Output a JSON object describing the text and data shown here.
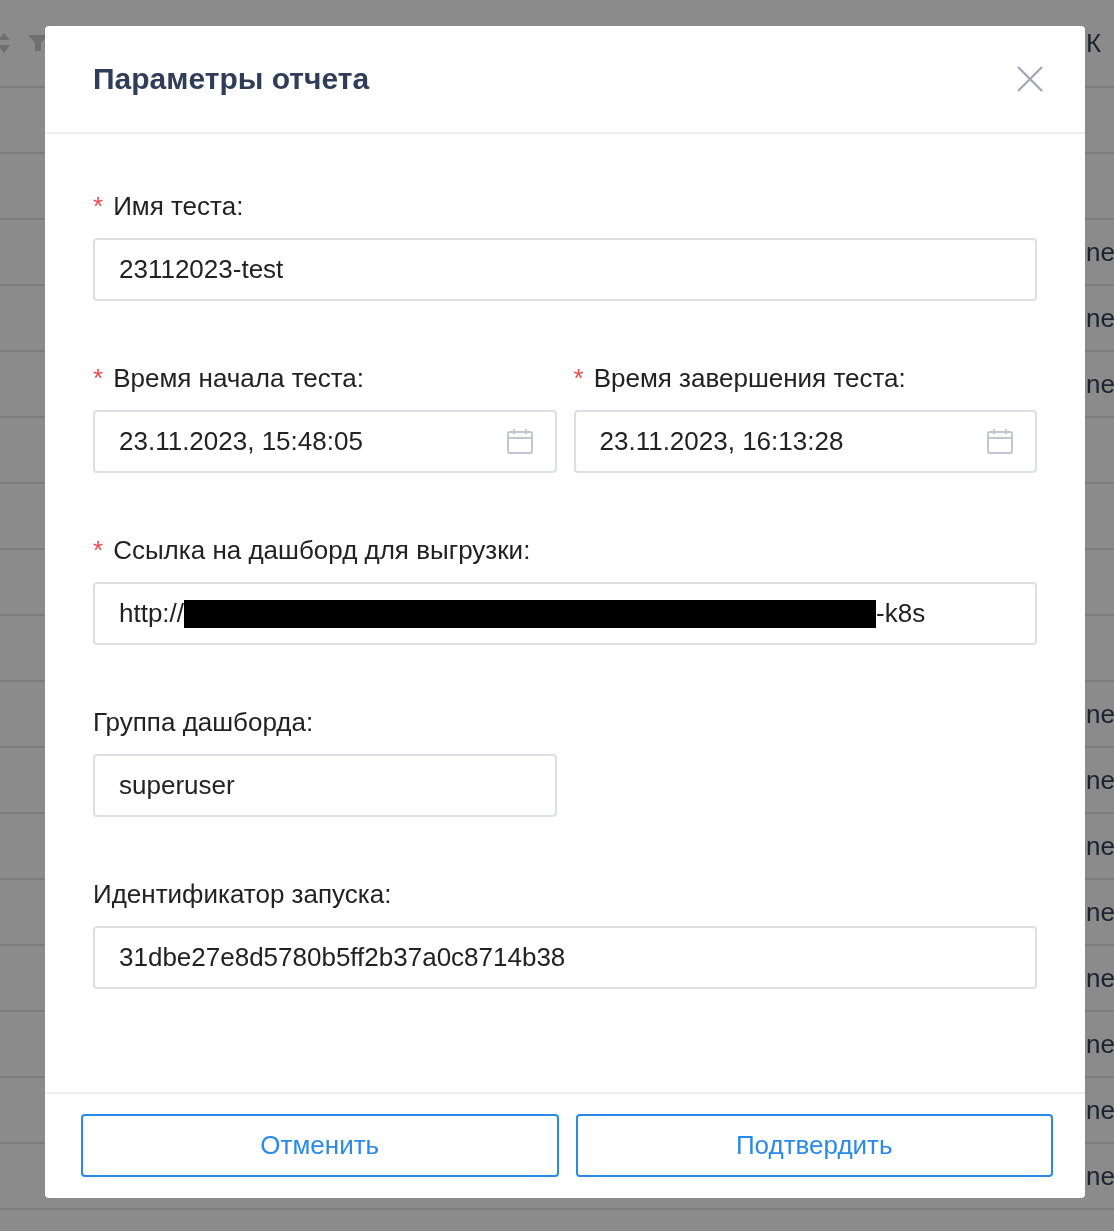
{
  "backdrop": {
    "header_text": "К",
    "rows": [
      {
        "kind": "blank"
      },
      {
        "kind": "blank"
      },
      {
        "kind": "text",
        "text": "ne"
      },
      {
        "kind": "text",
        "text": "ne"
      },
      {
        "kind": "text",
        "text": "ne"
      },
      {
        "kind": "blank"
      },
      {
        "kind": "blank"
      },
      {
        "kind": "blank"
      },
      {
        "kind": "blank"
      },
      {
        "kind": "text",
        "text": "ne"
      },
      {
        "kind": "text",
        "text": "ne"
      },
      {
        "kind": "text",
        "text": "ne"
      },
      {
        "kind": "text",
        "text": "ne"
      },
      {
        "kind": "text",
        "text": "ne"
      },
      {
        "kind": "text",
        "text": "ne"
      },
      {
        "kind": "text",
        "text": "ne"
      },
      {
        "kind": "text",
        "text": "ne"
      }
    ]
  },
  "dialog": {
    "title": "Параметры отчета",
    "form_rows": [
      {
        "fields": [
          {
            "kind": "text",
            "required_mark": "*",
            "label": "Имя теста:",
            "value": "23112023-test"
          }
        ]
      },
      {
        "fields": [
          {
            "kind": "date",
            "required_mark": "*",
            "label": "Время начала теста:",
            "value": "23.11.2023, 15:48:05"
          },
          {
            "kind": "date",
            "required_mark": "*",
            "label": "Время завершения теста:",
            "value": "23.11.2023, 16:13:28"
          }
        ]
      },
      {
        "fields": [
          {
            "kind": "redacted",
            "required_mark": "*",
            "label": "Ссылка на дашборд для выгрузки:",
            "value_start": "http://",
            "value_end": "-k8s"
          }
        ]
      },
      {
        "fields": [
          {
            "kind": "short_text",
            "label": "Группа дашборда:",
            "value": "superuser"
          }
        ]
      },
      {
        "fields": [
          {
            "kind": "text",
            "label": "Идентификатор запуска:",
            "value": "31dbe27e8d5780b5ff2b37a0c8714b38"
          }
        ]
      }
    ],
    "buttons": [
      "Отменить",
      "Подтвердить"
    ]
  }
}
